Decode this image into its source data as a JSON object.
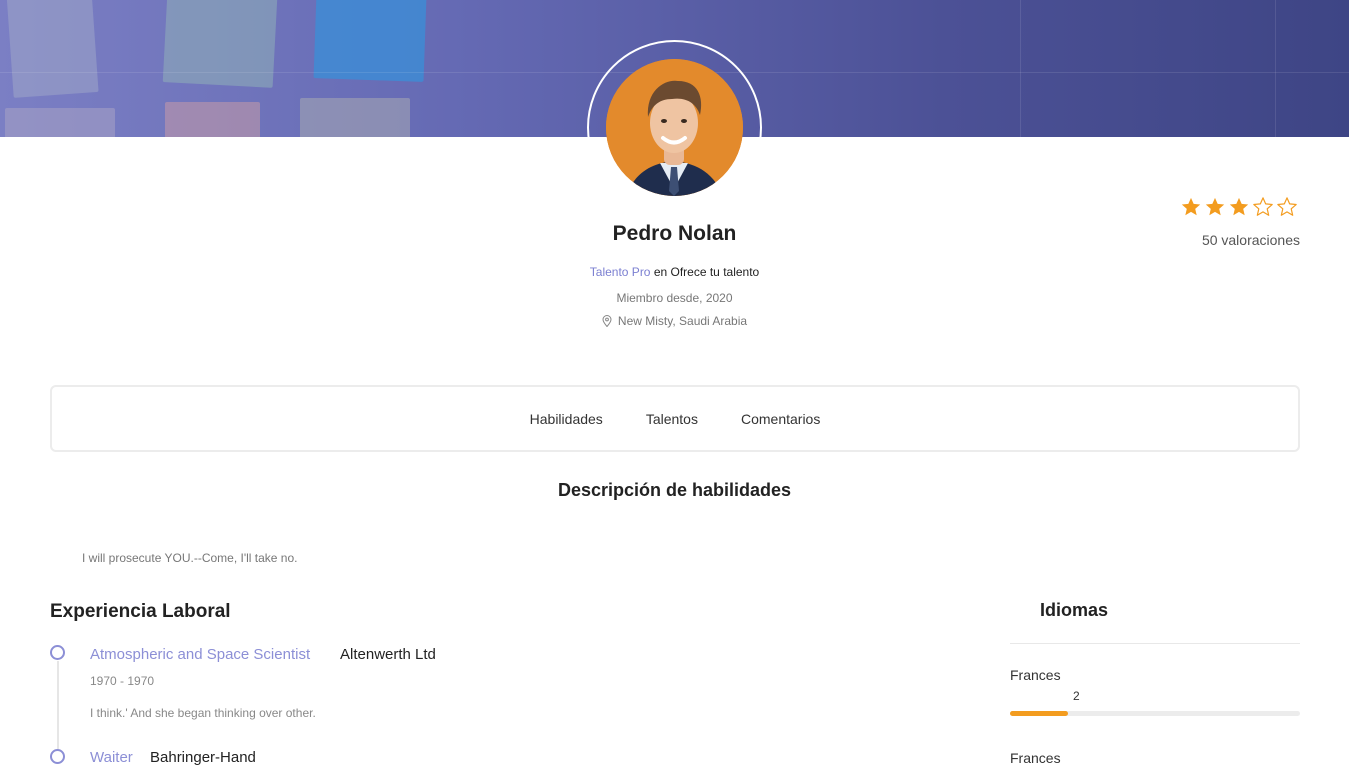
{
  "profile": {
    "name": "Pedro Nolan",
    "role_accent": "Talento Pro",
    "role_rest": " en Ofrece tu talento",
    "member_since": "Miembro desde, 2020",
    "location": "New Misty, Saudi Arabia"
  },
  "rating": {
    "stars": 3,
    "max_stars": 5,
    "count_label": "50 valoraciones",
    "star_color": "#f39c1f"
  },
  "tabs": [
    {
      "label": "Habilidades"
    },
    {
      "label": "Talentos"
    },
    {
      "label": "Comentarios"
    }
  ],
  "skills": {
    "title": "Descripción de habilidades",
    "description": "I will prosecute YOU.--Come, I'll take no."
  },
  "experience": {
    "title": "Experiencia Laboral",
    "items": [
      {
        "title": "Atmospheric and Space Scientist",
        "company": "Altenwerth Ltd",
        "years": "1970 - 1970",
        "description": "I think.' And she began thinking over other."
      },
      {
        "title": "Waiter",
        "company": "Bahringer-Hand"
      }
    ]
  },
  "languages": {
    "title": "Idiomas",
    "items": [
      {
        "name": "Frances",
        "level": "2",
        "level_fraction": 0.2
      },
      {
        "name": "Frances"
      }
    ]
  },
  "colors": {
    "accent": "#8c8fd6",
    "bar": "#f39c1f",
    "avatar_bg": "#e38a2c",
    "banner": "#5a5fa8"
  },
  "icons": {
    "location": "map-pin-icon",
    "star_full": "star-filled-icon",
    "star_empty": "star-outline-icon"
  }
}
